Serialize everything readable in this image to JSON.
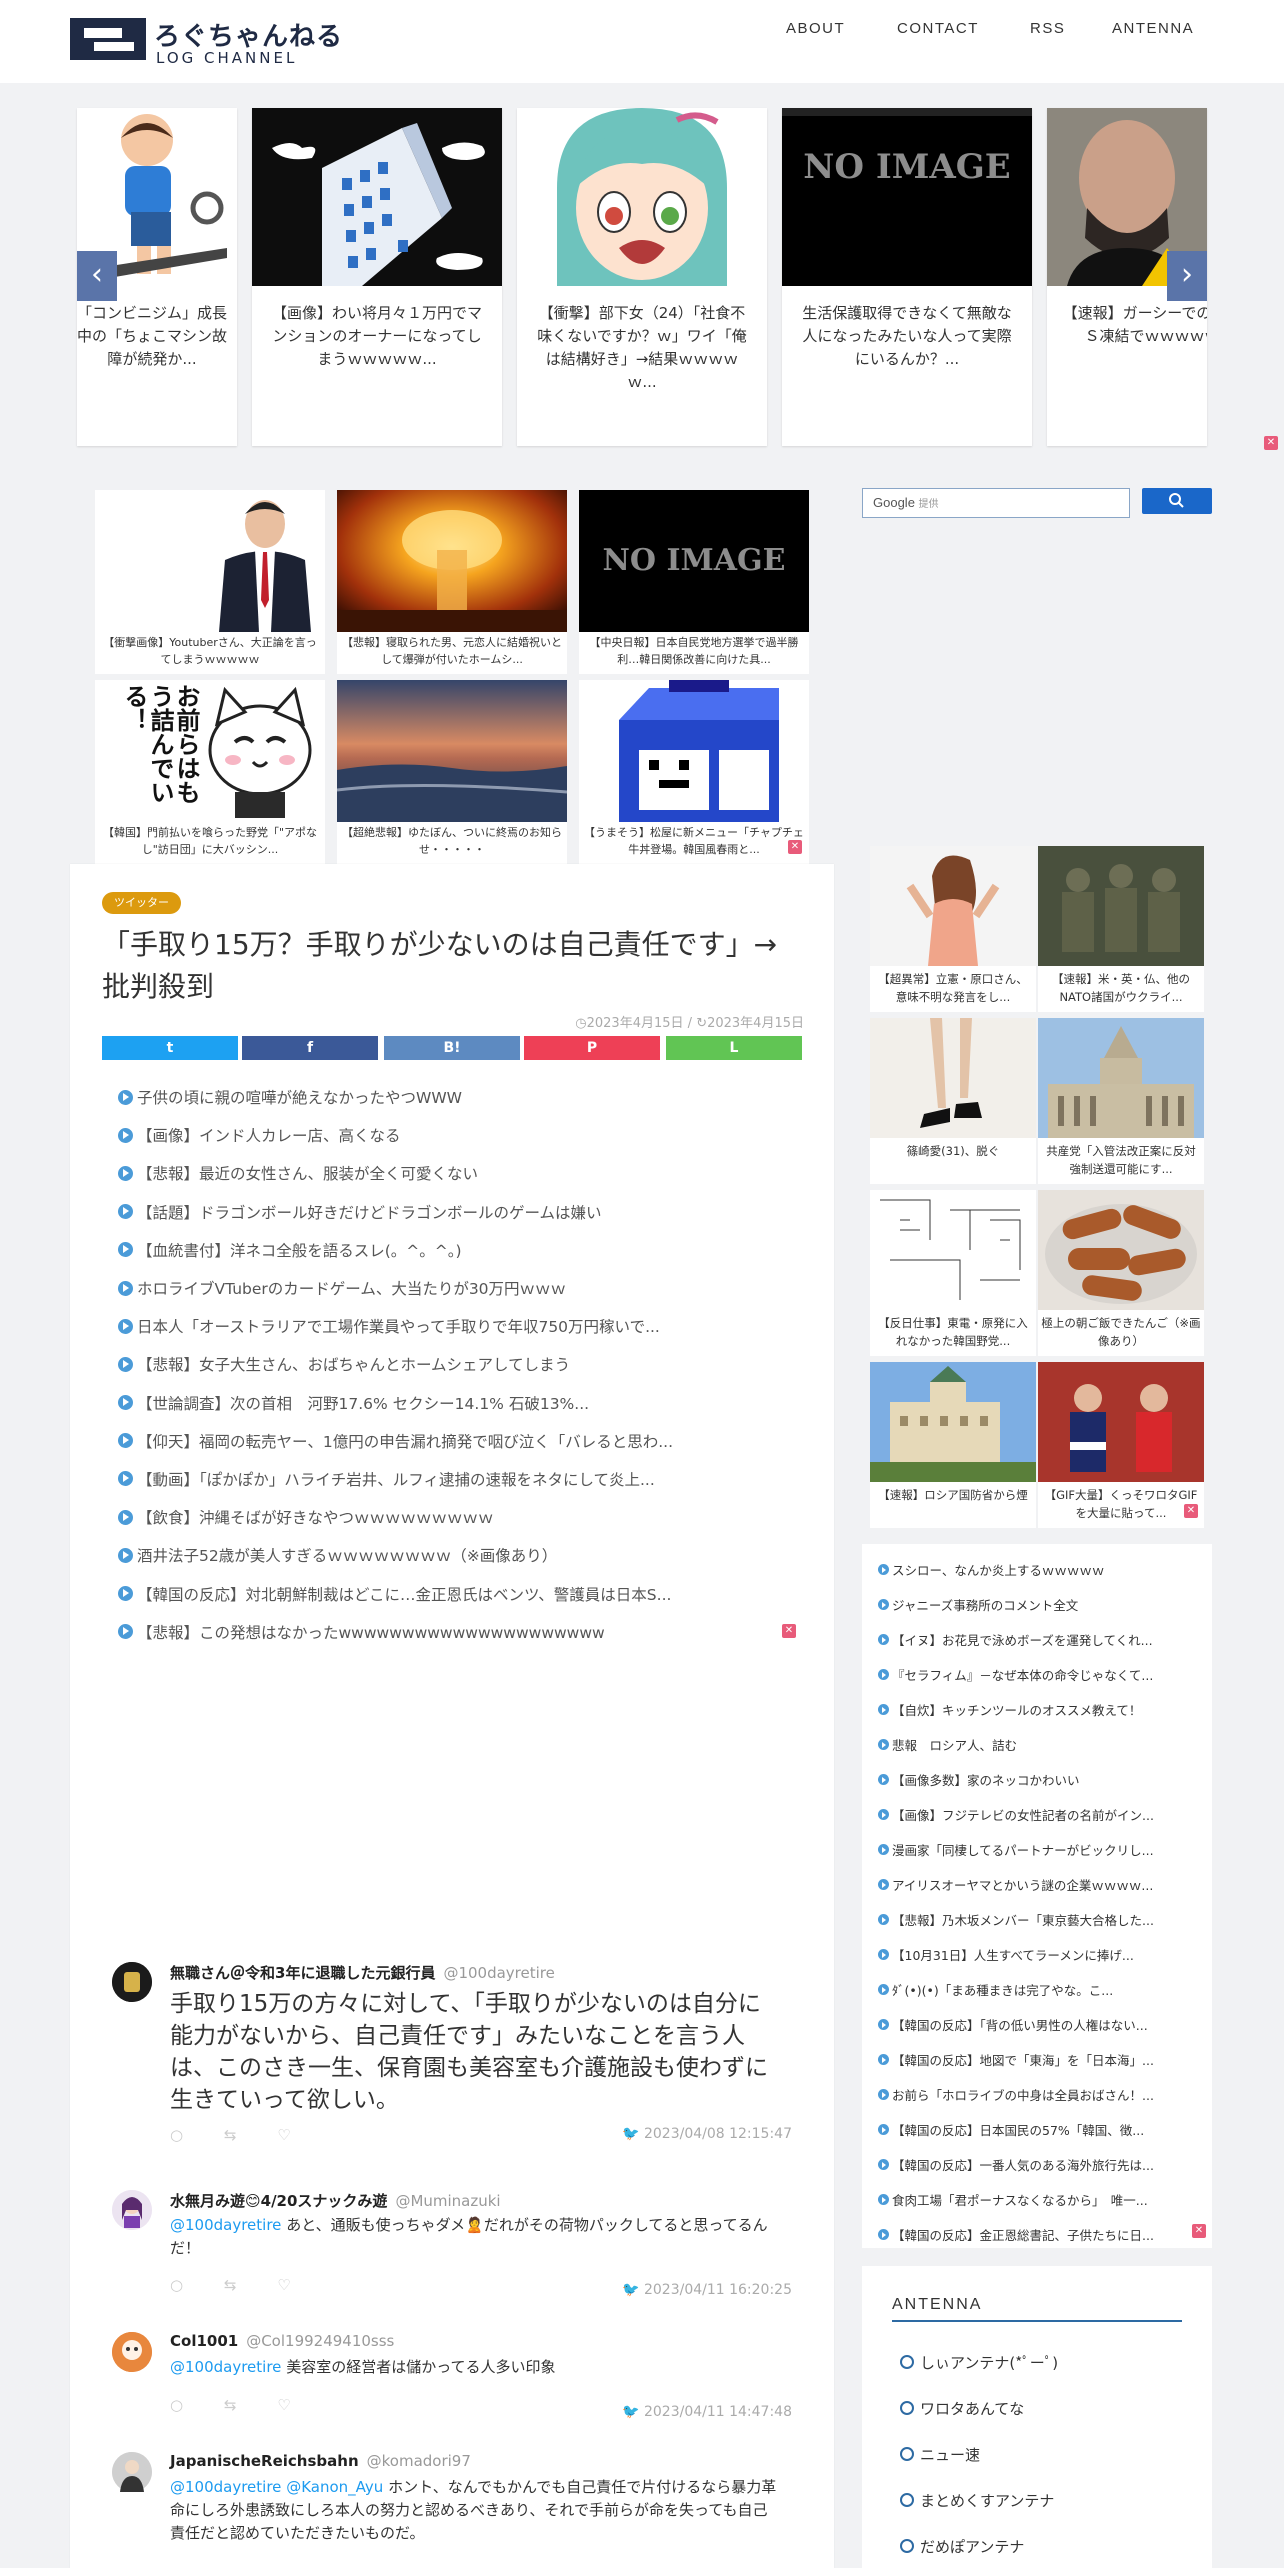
{
  "header": {
    "logo_jp": "ろぐちゃんねる",
    "logo_en": "LOG CHANNEL",
    "nav": [
      "ABOUT",
      "CONTACT",
      "RSS",
      "ANTENNA"
    ]
  },
  "carousel": {
    "items": [
      {
        "title": "「コンビニジム」成長中の「ちょこマシン故障が続発か..."
      },
      {
        "title": "【画像】わい将月々１万円でマンションのオーナーになってしまうｗｗｗｗｗ..."
      },
      {
        "title": "【衝撃】部下女（24）「社食不味くないですか？ｗ」ワイ「俺は結構好き」→結果ｗｗｗｗｗ..."
      },
      {
        "title": "生活保護取得できなくて無敵な人になったみたいな人って実際にいるんか？..."
      },
      {
        "title": "【速報】ガーシーでのＳＮＳ凍結でｗｗｗｗｗ"
      }
    ],
    "no_image": "NO IMAGE"
  },
  "grid": [
    {
      "title": "【衝撃画像】Youtuberさん、大正論を言ってしまうｗｗｗｗｗ"
    },
    {
      "title": "【悲報】寝取られた男、元恋人に結婚祝いとして爆弾が付いたホームシ..."
    },
    {
      "title": "【中央日報】日本自民党地方選挙で過半勝利…韓日関係改善に向けた具..."
    },
    {
      "title": "【韓国】門前払いを喰らった野党「\"アポなし\"訪日団」に大バッシン..."
    },
    {
      "title": "【超絶悲報】ゆたぼん、ついに終焉のお知らせ・・・・・"
    },
    {
      "title": "【うまそう】松屋に新メニュー「チャプチェ牛丼登場。韓国風春雨と..."
    }
  ],
  "grid_side_text": "お前らはもう詰んでいる！",
  "article": {
    "category": "ツイッター",
    "title": "「手取り15万？手取りが少ないのは自己責任です」→批判殺到",
    "date_posted": "2023年4月15日",
    "date_sep": "/",
    "date_updated": "2023年4月15日",
    "share": [
      "t",
      "f",
      "B!",
      "P",
      "L"
    ],
    "related": [
      "子供の頃に親の喧嘩が絶えなかったやつWWW",
      "【画像】インド人カレー店、高くなる",
      "【悲報】最近の女性さん、服装が全く可愛くない",
      "【話題】ドラゴンボール好きだけどドラゴンボールのゲームは嫌い",
      "【血統書付】洋ネコ全般を語るスレ(。^。^。)",
      "ホロライブVTuberのカードゲーム、大当たりが30万円ｗｗｗ",
      "日本人「オーストラリアで工場作業員やって手取りで年収750万円稼いで...",
      "【悲報】女子大生さん、おばちゃんとホームシェアしてしまう",
      "【世論調査】次の首相　河野17.6% セクシー14.1% 石破13%...",
      "【仰天】福岡の転売ヤー、1億円の申告漏れ摘発で咽び泣く「バレると思わ...",
      "【動画】「ぽかぽか」ハライチ岩井、ルフィ逮捕の速報をネタにして炎上...",
      "【飲食】沖縄そばが好きなやつｗｗｗｗｗｗｗｗｗ",
      "酒井法子52歳が美人すぎるｗｗｗｗｗｗｗｗ（※画像あり）",
      "【韓国の反応】対北朝鮮制裁はどこに…金正恩氏はベンツ、警護員は日本S...",
      "【悲報】この発想はなかったwwwwwwwwwwwwwwwwwwwww"
    ],
    "tweets": [
      {
        "name": "無職さん＠令和3年に退職した元銀行員",
        "handle": "@100dayretire",
        "mentions": [],
        "text": "手取り15万の方々に対して、「手取りが少ないのは自分に能力がないから、自己責任です」みたいなことを言う人は、このさき一生、保育園も美容室も介護施設も使わずに生きていって欲しい。",
        "date": "2023/04/08 12:15:47"
      },
      {
        "name": "水無月み遊😊4/20スナックみ遊",
        "handle": "@Muminazuki",
        "mentions": [
          "@100dayretire"
        ],
        "text": "あと、通販も使っちゃダメ🙎だれがその荷物パックしてると思ってるんだ！",
        "date": "2023/04/11 16:20:25"
      },
      {
        "name": "Col1001",
        "handle": "@Col199249410sss",
        "mentions": [
          "@100dayretire"
        ],
        "text": "美容室の経営者は儲かってる人多い印象",
        "date": "2023/04/11 14:47:48"
      },
      {
        "name": "JapanischeReichsbahn",
        "handle": "@komadori97",
        "mentions": [
          "@100dayretire",
          "@Kanon_Ayu"
        ],
        "text": "ホント、なんでもかんでも自己責任で片付けるなら暴力革命にしろ外患誘致にしろ本人の努力と認めるべきあり、それで手前らが命を失っても自己責任だと認めていただきたいものだ。",
        "date": ""
      }
    ],
    "tweet_actions": "○ ⇆ ♡",
    "twitter_bird": "🐦"
  },
  "sidebar": {
    "search_label": "Google",
    "search_sub": "提供",
    "cards": [
      {
        "title": "【超異常】立憲・原口さん、意味不明な発言をし..."
      },
      {
        "title": "【速報】米・英・仏、他のNATO諸国がウクライ..."
      },
      {
        "title": "篠崎愛(31)、脱ぐ"
      },
      {
        "title": "共産党「入管法改正案に反対　強制送還可能にす..."
      },
      {
        "title": "【反日仕事】東電・原発に入れなかった韓国野党..."
      },
      {
        "title": "極上の朝ご飯できたんご（※画像あり）"
      },
      {
        "title": "【速報】ロシア国防省から煙"
      },
      {
        "title": "【GIF大量】くっそワロタGIFを大量に貼って..."
      }
    ],
    "links": [
      "スシロー、なんか炎上するｗｗｗｗｗ",
      "ジャニーズ事務所のコメント全文",
      "【イヌ】お花見で泳めボーズを運発してくれ...",
      "『セラフィム』－なぜ本体の命令じゃなくて...",
      "【自炊】キッチンツールのオススメ教えて！",
      "悲報　ロシア人、詰む",
      "【画像多数】家のネッコかわいい",
      "【画像】フジテレビの女性記者の名前がイン...",
      "漫画家「同棲してるパートナーがビックリし...",
      "アイリスオーヤマとかいう謎の企業ｗｗｗｗ...",
      "【悲報】乃木坂メンバー「東京藝大合格した...",
      "【10月31日】人生すべてラーメンに捧げ...",
      "ﾀﾞ(•)(•)「まあ種まきは完了やな。こ...",
      "【韓国の反応】「背の低い男性の人権はない...",
      "【韓国の反応】地図で「東海」を「日本海」...",
      "お前ら「ホロライブの中身は全員おばさん！...",
      "【韓国の反応】日本国民の57%「韓国、徴...",
      "【韓国の反応】一番人気のある海外旅行先は...",
      "食肉工場「君ポーナスなくなるから」　唯一...",
      "【韓国の反応】金正恩総書記、子供たちに日..."
    ],
    "antenna_title": "ANTENNA",
    "antennas": [
      "しぃアンテナ(*ﾟーﾟ)",
      "ワロタあんてな",
      "ニュー速",
      "まとめくすアンテナ",
      "だめぽアンテナ"
    ]
  },
  "colors": {
    "navy": "#1f2a44",
    "twitter": "#1da1f2",
    "facebook": "#3b5998",
    "hatena": "#5d8ac1",
    "pocket": "#ee4056",
    "line": "#61c554",
    "category": "#dc9a0e",
    "bullet": "#4b9bd8"
  }
}
